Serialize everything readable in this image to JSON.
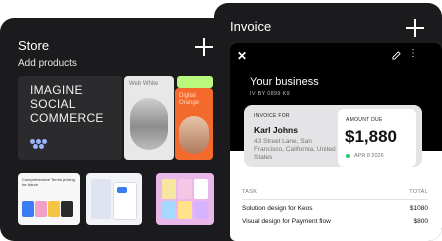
{
  "store": {
    "title": "Store",
    "subtitle": "Add products",
    "tiles": {
      "imagine": "IMAGINE SOCIAL COMMERCE",
      "web_white": "Web White",
      "digital_orange": "Digital Orange",
      "b1_text": "Comprehensive Terms pricing for future"
    }
  },
  "invoice": {
    "title": "Invoice",
    "business_name": "Your business",
    "business_id": "IV BY 0899 K9",
    "invoice_for_label": "INVOICE FOR",
    "client_name": "Karl Johns",
    "client_address": "43 Street Lane, San Francisco, California, United States",
    "amount_due_label": "AMOUNT DUE",
    "amount_due": "$1,880",
    "due_date": "APR 8 2026",
    "table": {
      "task_header": "TASK",
      "total_header": "TOTAL",
      "rows": [
        {
          "task": "Solution design for Keos",
          "total": "$1080"
        },
        {
          "task": "Visual design for Payment flow",
          "total": "$800"
        }
      ]
    }
  },
  "colors": {
    "panel": "#1b1b1d",
    "accent_orange": "#f46a2c",
    "accent_green": "#b9f87c",
    "status_green": "#2ecc71"
  },
  "icons": [
    "plus-icon",
    "close-icon",
    "edit-icon",
    "more-vertical-icon"
  ]
}
